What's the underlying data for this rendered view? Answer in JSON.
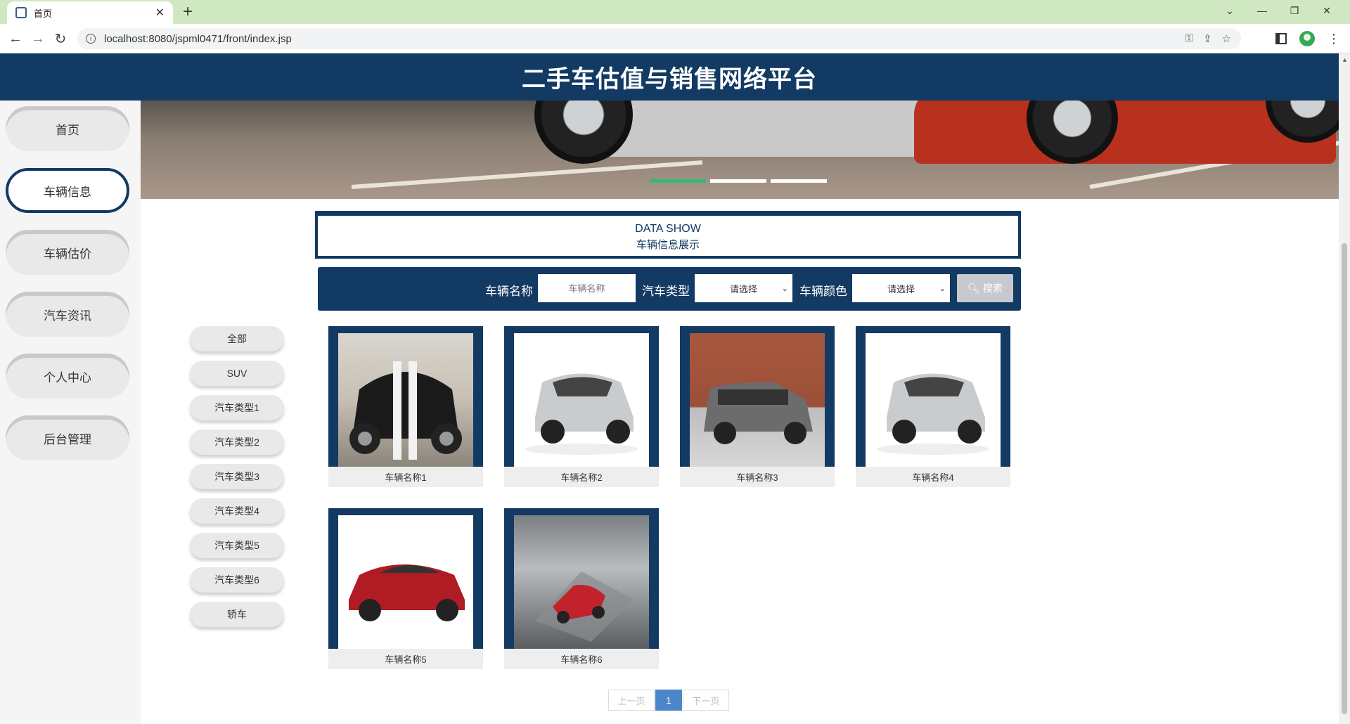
{
  "browser": {
    "tab_title": "首页",
    "url": "localhost:8080/jspml0471/front/index.jsp"
  },
  "site": {
    "title": "二手车估值与销售网络平台"
  },
  "side_nav": [
    {
      "label": "首页",
      "active": false
    },
    {
      "label": "车辆信息",
      "active": true
    },
    {
      "label": "车辆估价",
      "active": false
    },
    {
      "label": "汽车资讯",
      "active": false
    },
    {
      "label": "个人中心",
      "active": false
    },
    {
      "label": "后台管理",
      "active": false
    }
  ],
  "section": {
    "title_en": "DATA SHOW",
    "title_cn": "车辆信息展示"
  },
  "search": {
    "name_label": "车辆名称",
    "name_placeholder": "车辆名称",
    "type_label": "汽车类型",
    "type_value": "请选择",
    "color_label": "车辆颜色",
    "color_value": "请选择",
    "button_label": "搜索"
  },
  "categories": [
    "全部",
    "SUV",
    "汽车类型1",
    "汽车类型2",
    "汽车类型3",
    "汽车类型4",
    "汽车类型5",
    "汽车类型6",
    "轿车"
  ],
  "products": [
    {
      "name": "车辆名称1"
    },
    {
      "name": "车辆名称2"
    },
    {
      "name": "车辆名称3"
    },
    {
      "name": "车辆名称4"
    },
    {
      "name": "车辆名称5"
    },
    {
      "name": "车辆名称6"
    }
  ],
  "pagination": {
    "prev": "上一页",
    "current": "1",
    "next": "下一页"
  },
  "colors": {
    "brand_navy": "#123a63",
    "carousel_active": "#37b67a",
    "pager_active": "#4a86c8"
  }
}
